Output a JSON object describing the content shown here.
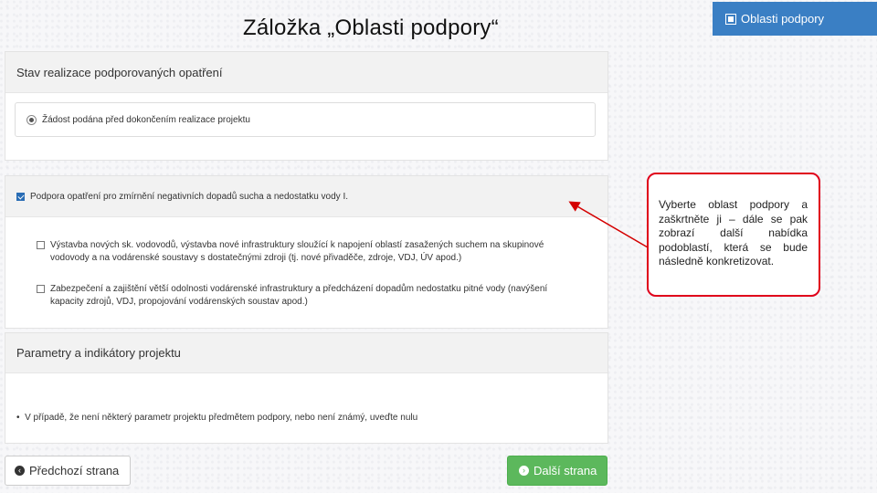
{
  "slide": {
    "title": "Záložka „Oblasti podpory“",
    "tab_badge": "Oblasti podpory"
  },
  "panel_status": {
    "heading": "Stav realizace podporovaných opatření",
    "radio_label": "Žádost podána před dokončením realizace projektu",
    "radio_selected": true
  },
  "panel_support": {
    "heading": "Podpora opatření pro zmírnění negativních dopadů sucha a nedostatku vody I.",
    "heading_checked": true,
    "items": [
      {
        "label": "Výstavba nových sk. vodovodů, výstavba nové infrastruktury sloužící k napojení oblastí zasažených suchem na skupinové vodovody a na vodárenské soustavy s dostatečnými zdroji (tj. nové přivaděče, zdroje, VDJ, ÚV apod.)",
        "checked": false
      },
      {
        "label": "Zabezpečení a zajištění větší odolnosti vodárenské infrastruktury a předcházení dopadům nedostatku pitné vody (navýšení kapacity zdrojů, VDJ, propojování vodárenských soustav apod.)",
        "checked": false
      }
    ]
  },
  "panel_params": {
    "heading": "Parametry a indikátory projektu",
    "bullet": "V případě, že není některý parametr projektu předmětem podpory, nebo není známý, uveďte nulu"
  },
  "buttons": {
    "prev_label": "Předchozí strana",
    "next_label": "Další strana"
  },
  "callout": {
    "text": "Vyberte oblast podpory a zaškrtněte ji – dále se pak zobrazí další nabídka podoblastí, která se bude následně konkretizovat."
  },
  "colors": {
    "tab_badge": "#3a7fc4",
    "next_button": "#5cb85c",
    "callout_border": "#e0001b",
    "arrow": "#d40000"
  }
}
